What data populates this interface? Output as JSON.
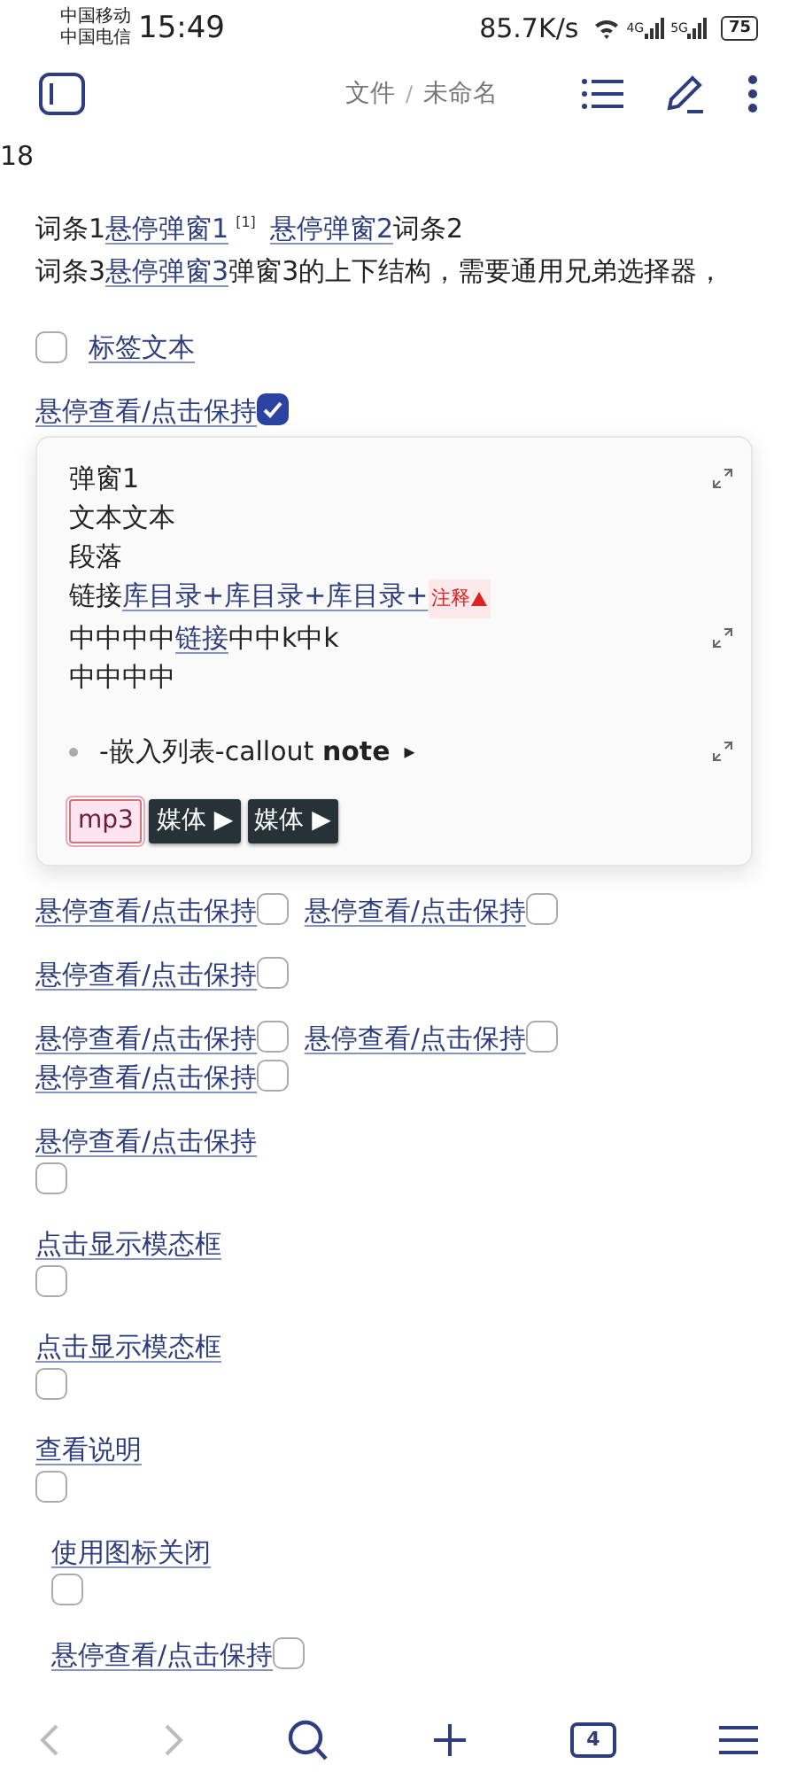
{
  "status_bar": {
    "carriers": [
      "中国移动",
      "中国电信"
    ],
    "time": "15:49",
    "speed": "85.7K/s",
    "network_labels": [
      "4G",
      "5G"
    ],
    "battery": "75"
  },
  "header": {
    "breadcrumb": [
      "文件",
      "未命名"
    ],
    "separator": "/"
  },
  "counter": "18",
  "paragraph_lines": [
    [
      {
        "kind": "text",
        "text": "词条1"
      },
      {
        "kind": "link",
        "text": "悬停弹窗1"
      },
      {
        "kind": "footnote",
        "text": "[1]"
      },
      {
        "kind": "link",
        "text": "悬停弹窗2"
      },
      {
        "kind": "text",
        "text": "词条2"
      }
    ],
    [
      {
        "kind": "text",
        "text": "词条3"
      },
      {
        "kind": "link",
        "text": "悬停弹窗3"
      },
      {
        "kind": "text",
        "text": "弹窗3的上下结构，需要通用兄弟选择器，"
      }
    ]
  ],
  "blocks": [
    {
      "kind": "task",
      "indented": false,
      "items": [
        {
          "label": "标签文本",
          "checked": false
        }
      ]
    },
    {
      "kind": "inline",
      "indented": false,
      "items": [
        {
          "label": "悬停查看/点击保持",
          "checked": true
        }
      ]
    },
    {
      "kind": "popup",
      "lines": [
        [
          {
            "kind": "text",
            "text": "弹窗1"
          }
        ],
        [
          {
            "kind": "text",
            "text": "文本文本"
          }
        ],
        [
          {
            "kind": "text",
            "text": "段落"
          }
        ],
        [
          {
            "kind": "text",
            "text": "链接"
          },
          {
            "kind": "link",
            "text": "库目录+库目录+库目录+"
          },
          {
            "kind": "note",
            "text": "注释"
          }
        ],
        [
          {
            "kind": "text",
            "text": "中中中中"
          },
          {
            "kind": "link",
            "text": "链接"
          },
          {
            "kind": "text",
            "text": "中中k中k"
          }
        ],
        [
          {
            "kind": "text",
            "text": "中中中中"
          }
        ]
      ],
      "expand_icon_lines": [
        true,
        false,
        false,
        false,
        true,
        false
      ],
      "list_item": {
        "text": "-嵌入列表-callout **note**",
        "toggle": "▸",
        "expand_icon": true
      },
      "media": [
        {
          "kind": "audio",
          "label": "mp3"
        },
        {
          "kind": "video",
          "label": "媒体 ▶"
        },
        {
          "kind": "video",
          "label": "媒体 ▶"
        }
      ]
    },
    {
      "kind": "inline",
      "indented": false,
      "items": [
        {
          "label": "悬停查看/点击保持",
          "checked": false
        },
        {
          "label": "悬停查看/点击保持",
          "checked": false
        }
      ]
    },
    {
      "kind": "inline",
      "indented": false,
      "items": [
        {
          "label": "悬停查看/点击保持",
          "checked": false
        }
      ]
    },
    {
      "kind": "inline",
      "indented": false,
      "items": [
        {
          "label": "悬停查看/点击保持",
          "checked": false
        },
        {
          "label": "悬停查看/点击保持",
          "checked": false
        },
        {
          "label": "悬停查看/点击保持",
          "checked": false
        }
      ]
    },
    {
      "kind": "stacked",
      "indented": false,
      "items": [
        {
          "label": "悬停查看/点击保持",
          "checked": false
        }
      ]
    },
    {
      "kind": "stacked",
      "indented": false,
      "items": [
        {
          "label": "点击显示模态框",
          "checked": false
        }
      ]
    },
    {
      "kind": "stacked",
      "indented": false,
      "items": [
        {
          "label": "点击显示模态框",
          "checked": false
        }
      ]
    },
    {
      "kind": "stacked",
      "indented": false,
      "items": [
        {
          "label": "查看说明",
          "checked": false
        }
      ]
    },
    {
      "kind": "stacked",
      "indented": true,
      "items": [
        {
          "label": "使用图标关闭",
          "checked": false
        }
      ]
    },
    {
      "kind": "inline",
      "indented": true,
      "items": [
        {
          "label": "悬停查看/点击保持",
          "checked": false
        }
      ]
    }
  ],
  "bottom_nav": {
    "back_disabled": true,
    "forward_disabled": true,
    "tab_count": "4"
  }
}
